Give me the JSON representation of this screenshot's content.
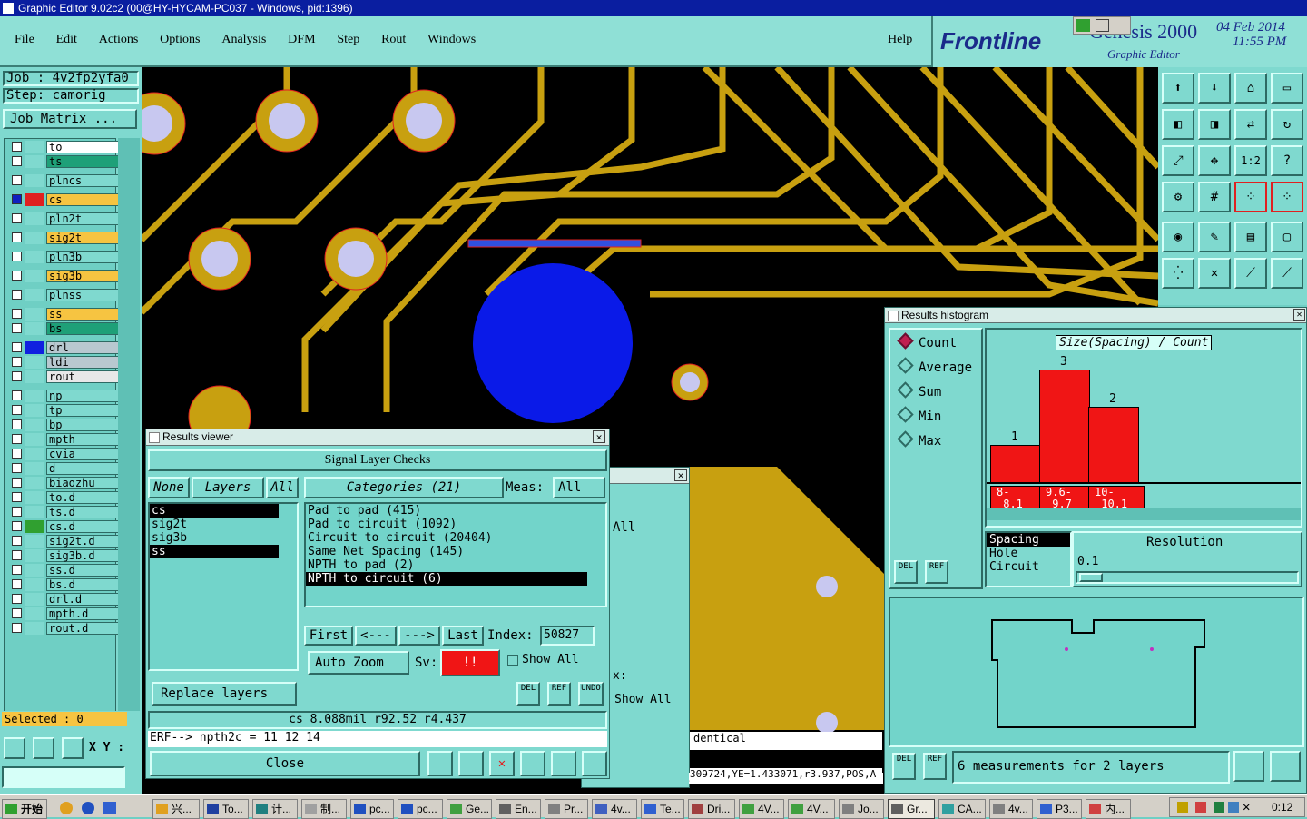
{
  "window": {
    "title": "Graphic Editor 9.02c2 (00@HY-HYCAM-PC037 - Windows, pid:1396)"
  },
  "menu": [
    "File",
    "Edit",
    "Actions",
    "Options",
    "Analysis",
    "DFM",
    "Step",
    "Rout",
    "Windows"
  ],
  "help_label": "Help",
  "brand": {
    "logo": "Frontline",
    "product": "Genesis 2000",
    "subtitle": "Graphic Editor",
    "date": "04 Feb 2014",
    "time": "11:55 PM"
  },
  "job": {
    "job_label": "Job : 4v2fp2yfa0",
    "step_label": "Step: camorig",
    "matrix_button": "Job Matrix ..."
  },
  "layers": [
    {
      "name": "to",
      "color": "#ffffff"
    },
    {
      "name": "ts",
      "color": "#1ea078"
    },
    {
      "name": "plncs",
      "color": "#7fd9cf"
    },
    {
      "name": "cs",
      "color": "#f6c441"
    },
    {
      "name": "pln2t",
      "color": "#7fd9cf"
    },
    {
      "name": "sig2t",
      "color": "#f6c441"
    },
    {
      "name": "pln3b",
      "color": "#7fd9cf"
    },
    {
      "name": "sig3b",
      "color": "#f6c441"
    },
    {
      "name": "plnss",
      "color": "#7fd9cf"
    },
    {
      "name": "ss",
      "color": "#f6c441"
    },
    {
      "name": "bs",
      "color": "#1ea078"
    },
    {
      "name": "drl",
      "color": "#b8c8d0"
    },
    {
      "name": "ldi",
      "color": "#b8c8d0"
    },
    {
      "name": "rout",
      "color": "#e8e8e8"
    },
    {
      "name": "np",
      "color": "#7fd9cf"
    },
    {
      "name": "tp",
      "color": "#7fd9cf"
    },
    {
      "name": "bp",
      "color": "#7fd9cf"
    },
    {
      "name": "mpth",
      "color": "#7fd9cf"
    },
    {
      "name": "cvia",
      "color": "#7fd9cf"
    },
    {
      "name": "d",
      "color": "#7fd9cf"
    },
    {
      "name": "biaozhu",
      "color": "#7fd9cf"
    },
    {
      "name": "to.d",
      "color": "#7fd9cf"
    },
    {
      "name": "ts.d",
      "color": "#7fd9cf"
    },
    {
      "name": "cs.d",
      "color": "#7fd9cf"
    },
    {
      "name": "sig2t.d",
      "color": "#7fd9cf"
    },
    {
      "name": "sig3b.d",
      "color": "#7fd9cf"
    },
    {
      "name": "ss.d",
      "color": "#7fd9cf"
    },
    {
      "name": "bs.d",
      "color": "#7fd9cf"
    },
    {
      "name": "drl.d",
      "color": "#7fd9cf"
    },
    {
      "name": "mpth.d",
      "color": "#7fd9cf"
    },
    {
      "name": "rout.d",
      "color": "#7fd9cf"
    }
  ],
  "selected_label": "Selected : 0",
  "xy_label": "X Y :",
  "results_viewer": {
    "title": "Results viewer",
    "header": "Signal Layer Checks",
    "none_btn": "None",
    "layers_btn": "Layers",
    "all_btn": "All",
    "categories_btn": "Categories (21)",
    "meas_label": "Meas:",
    "meas_value": "All",
    "layer_list": [
      "cs",
      "sig2t",
      "sig3b",
      "ss"
    ],
    "categories": [
      "Pad to pad (415)",
      "Pad to circuit (1092)",
      "Circuit to circuit (20404)",
      "Same Net Spacing (145)",
      "NPTH to pad (2)",
      "NPTH to circuit (6)"
    ],
    "nav": {
      "first": "First",
      "prev": "<---",
      "next": "--->",
      "last": "Last",
      "index_label": "Index:",
      "index_value": "50827"
    },
    "auto_zoom": "Auto Zoom",
    "sv_label": "Sv:",
    "sv_value": "!!",
    "show_all": "Show All",
    "replace_layers": "Replace layers",
    "del": "DEL",
    "ref": "REF",
    "undo": "UNDO",
    "measure_text": "cs 8.088mil  r92.52  r4.437",
    "erf_text": "ERF--> npth2c = 11 12 14",
    "close": "Close"
  },
  "behind_window": {
    "meas_value": "All",
    "x_label": "x:",
    "show_all": "Show All",
    "identical": "dentical",
    "status": "309724,YE=1.433071,r3.937,POS,A"
  },
  "histogram": {
    "title": "Results histogram",
    "modes": [
      "Count",
      "Average",
      "Sum",
      "Min",
      "Max"
    ],
    "active_mode": "Count",
    "chart_title": "Size(Spacing) / Count",
    "bars": [
      {
        "label": "8-\n 8.1",
        "value": 1
      },
      {
        "label": "9.6-\n 9.7",
        "value": 3
      },
      {
        "label": "10-\n 10.1",
        "value": 2
      }
    ],
    "types": [
      "Spacing",
      "Hole",
      "Circuit"
    ],
    "resolution_label": "Resolution",
    "resolution_value": "0.1",
    "summary": "6 measurements for 2 layers"
  },
  "taskbar": {
    "start": "开始",
    "tasks": [
      "兴...",
      "To...",
      "计...",
      "制...",
      "pc...",
      "pc...",
      "Ge...",
      "En...",
      "Pr...",
      "4v...",
      "Te...",
      "Dri...",
      "4V...",
      "4V...",
      "Jo...",
      "Gr...",
      "CA...",
      "4v...",
      "P3...",
      "内..."
    ],
    "clock": "0:12"
  }
}
